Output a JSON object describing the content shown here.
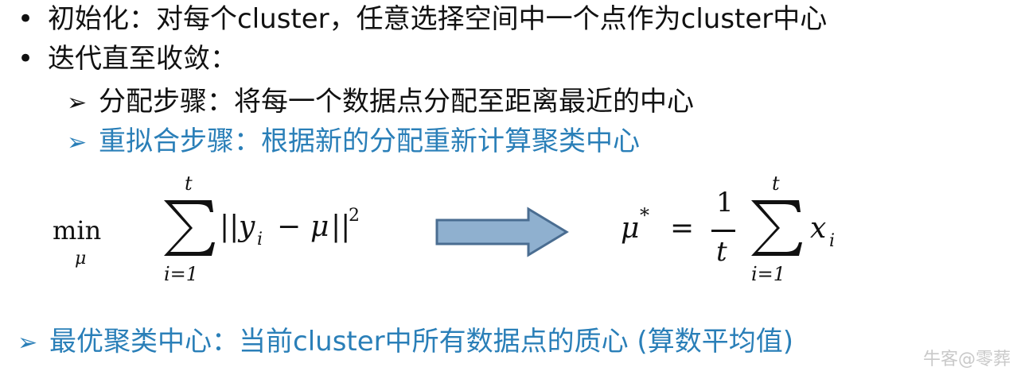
{
  "bullets": {
    "b1": {
      "marker": "•",
      "text": "初始化：对每个cluster，任意选择空间中一个点作为cluster中心"
    },
    "b2": {
      "marker": "•",
      "text": "迭代直至收敛："
    },
    "sub1": {
      "marker": "➢",
      "text": "分配步骤：将每一个数据点分配至距离最近的中心"
    },
    "sub2": {
      "marker": "➢",
      "text": "重拟合步骤：根据新的分配重新计算聚类中心"
    },
    "bottom": {
      "marker": "➢",
      "text": "最优聚类中心：当前cluster中所有数据点的质心 (算数平均值)"
    }
  },
  "formula_left": {
    "min": "min",
    "min_sub": "μ",
    "sum_top": "t",
    "sum_bottom": "i=1",
    "expr_open": "||",
    "expr_y": "y",
    "expr_i": "i",
    "expr_minus": "−",
    "expr_mu": "μ",
    "expr_close": "||",
    "expr_exp": "2"
  },
  "formula_right": {
    "mu": "μ",
    "star": "*",
    "equals": "=",
    "frac_num": "1",
    "frac_den": "t",
    "sum_top": "t",
    "sum_bottom": "i=1",
    "x": "x",
    "x_sub": "i"
  },
  "watermark": "牛客@零葬",
  "colors": {
    "text": "#111111",
    "accent_blue": "#2a7fb8",
    "arrow_fill": "#8fb0cf",
    "arrow_stroke": "#4a6d91"
  }
}
